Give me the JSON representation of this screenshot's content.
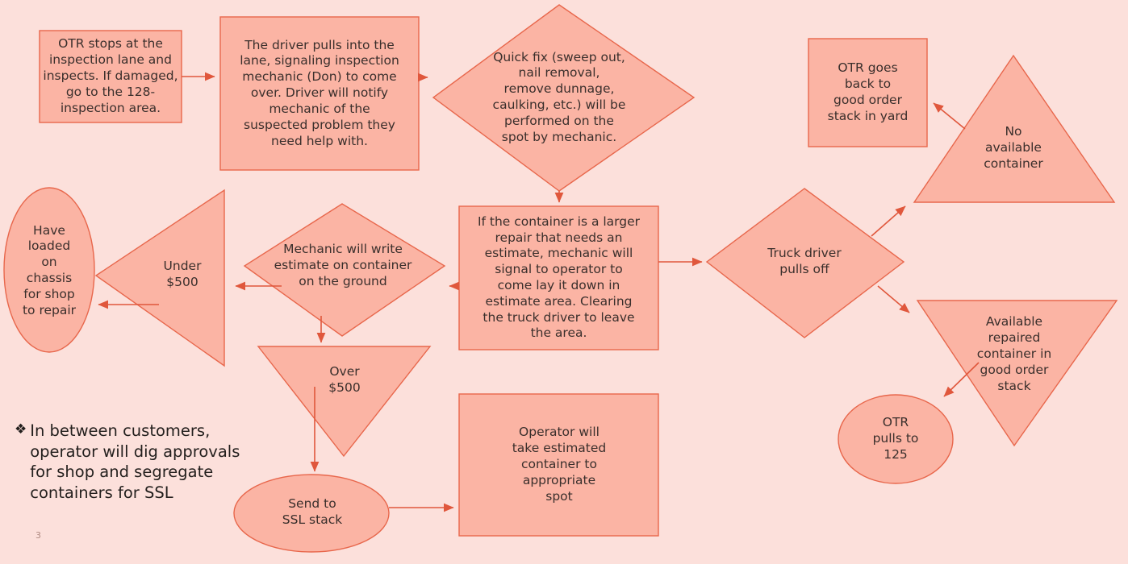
{
  "slide": {
    "page_number": "3",
    "background_color": "#fce0db",
    "shape_fill_color": "#fbb4a4",
    "shape_stroke_color": "#e8674c",
    "connector_color": "#e0573c",
    "text_color": "#3a2f2c"
  },
  "note": {
    "bullet_glyph": "❖",
    "text": "In between customers,\noperator will dig approvals\nfor shop and segregate\ncontainers for SSL"
  },
  "nodes": [
    {
      "id": "otr-stops-inspection",
      "shape": "rectangle",
      "text": "OTR stops at the\ninspection lane and\ninspects. If damaged,\ngo to the 128-\ninspection area."
    },
    {
      "id": "driver-pulls-into-lane",
      "shape": "rectangle",
      "text": "The driver pulls into the\nlane, signaling inspection\nmechanic (Don) to come\nover. Driver will notify\nmechanic of the\nsuspected problem they\nneed help with."
    },
    {
      "id": "quick-fix",
      "shape": "diamond",
      "text": "Quick fix (sweep out,\nnail removal,\nremove dunnage,\ncaulking, etc.) will be\nperformed on the\nspot by mechanic."
    },
    {
      "id": "otr-goes-back-good-order",
      "shape": "rectangle",
      "text": "OTR goes\nback to\ngood order\nstack in yard"
    },
    {
      "id": "no-available-container",
      "shape": "triangle-up",
      "text": "No\navailable\ncontainer"
    },
    {
      "id": "larger-repair-estimate",
      "shape": "rectangle",
      "text": "If the container is a larger\nrepair that needs an\nestimate, mechanic will\nsignal to operator to\ncome lay it down in\nestimate area. Clearing\nthe truck driver to leave\nthe area."
    },
    {
      "id": "truck-driver-pulls-off",
      "shape": "diamond",
      "text": "Truck driver\npulls off"
    },
    {
      "id": "available-repaired-container",
      "shape": "triangle-down",
      "text": "Available\nrepaired\ncontainer in\ngood order\nstack"
    },
    {
      "id": "otr-pulls-to-125",
      "shape": "ellipse",
      "text": "OTR\npulls to\n125"
    },
    {
      "id": "mechanic-write-estimate",
      "shape": "diamond",
      "text": "Mechanic will write\nestimate on container\non the ground"
    },
    {
      "id": "under-500",
      "shape": "triangle-left",
      "text": "Under\n$500"
    },
    {
      "id": "have-loaded-on-chassis",
      "shape": "ellipse",
      "text": "Have\nloaded\non\nchassis\nfor shop\nto repair"
    },
    {
      "id": "over-500",
      "shape": "triangle-down",
      "text": "Over\n$500"
    },
    {
      "id": "send-to-ssl-stack",
      "shape": "ellipse",
      "text": "Send to\nSSL stack"
    },
    {
      "id": "operator-take-estimated-container",
      "shape": "rectangle",
      "text": "Operator will\ntake estimated\ncontainer to\nappropriate\nspot"
    }
  ],
  "connectors": [
    {
      "id": "c1",
      "from": "otr-stops-inspection",
      "to": "driver-pulls-into-lane"
    },
    {
      "id": "c2",
      "from": "driver-pulls-into-lane",
      "to": "quick-fix"
    },
    {
      "id": "c3",
      "from": "quick-fix",
      "to": "larger-repair-estimate"
    },
    {
      "id": "c4",
      "from": "larger-repair-estimate",
      "to": "truck-driver-pulls-off"
    },
    {
      "id": "c5",
      "from": "truck-driver-pulls-off",
      "to": "no-available-container"
    },
    {
      "id": "c6",
      "from": "truck-driver-pulls-off",
      "to": "available-repaired-container"
    },
    {
      "id": "c7",
      "from": "no-available-container",
      "to": "otr-goes-back-good-order"
    },
    {
      "id": "c8",
      "from": "available-repaired-container",
      "to": "otr-pulls-to-125"
    },
    {
      "id": "c9",
      "from": "larger-repair-estimate",
      "to": "mechanic-write-estimate"
    },
    {
      "id": "c10",
      "from": "mechanic-write-estimate",
      "to": "under-500"
    },
    {
      "id": "c11",
      "from": "under-500",
      "to": "have-loaded-on-chassis"
    },
    {
      "id": "c12",
      "from": "mechanic-write-estimate",
      "to": "over-500"
    },
    {
      "id": "c13",
      "from": "over-500",
      "to": "send-to-ssl-stack"
    },
    {
      "id": "c14",
      "from": "send-to-ssl-stack",
      "to": "operator-take-estimated-container"
    }
  ]
}
